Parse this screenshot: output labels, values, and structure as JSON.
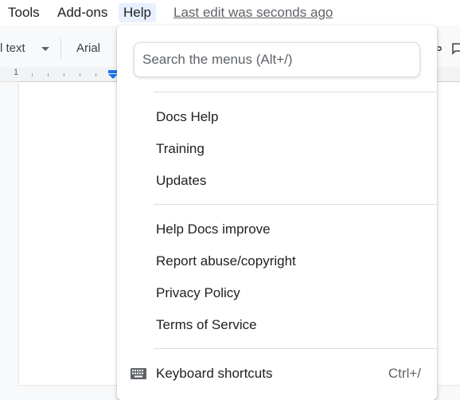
{
  "menubar": {
    "items": [
      {
        "label": "Tools"
      },
      {
        "label": "Add-ons"
      },
      {
        "label": "Help"
      }
    ],
    "last_edit": "Last edit was seconds ago"
  },
  "toolbar": {
    "style_label": "l text",
    "font_label": "Arial"
  },
  "ruler": {
    "marker": "1"
  },
  "help_menu": {
    "search_placeholder": "Search the menus (Alt+/)",
    "groups": [
      {
        "items": [
          {
            "label": "Docs Help"
          },
          {
            "label": "Training"
          },
          {
            "label": "Updates"
          }
        ]
      },
      {
        "items": [
          {
            "label": "Help Docs improve"
          },
          {
            "label": "Report abuse/copyright"
          },
          {
            "label": "Privacy Policy"
          },
          {
            "label": "Terms of Service"
          }
        ]
      },
      {
        "items": [
          {
            "label": "Keyboard shortcuts",
            "shortcut": "Ctrl+/",
            "icon": "keyboard-icon"
          }
        ]
      }
    ]
  },
  "colors": {
    "active_menu_bg": "#e8f0fe",
    "indent_marker": "#1a73e8",
    "text_primary": "#202124",
    "text_secondary": "#5f6368"
  }
}
